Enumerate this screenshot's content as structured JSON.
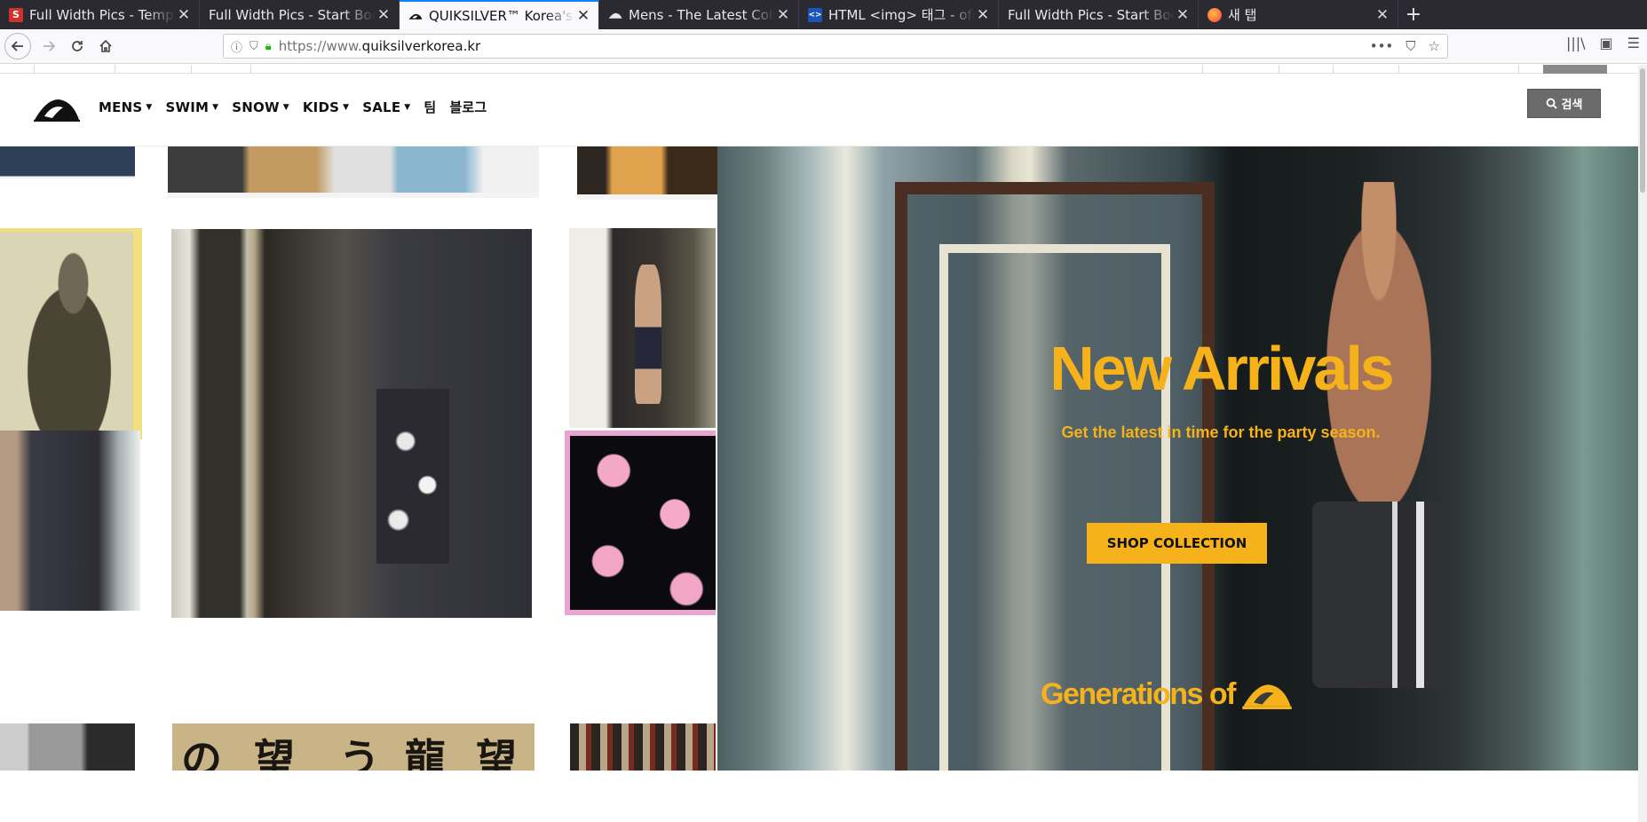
{
  "browser": {
    "tabs": [
      {
        "title": "Full Width Pics - Template",
        "favicon": "S",
        "favicon_bg": "#d0322b",
        "active": false
      },
      {
        "title": "Full Width Pics - Start Bootstrap",
        "favicon": "",
        "favicon_bg": "",
        "active": false
      },
      {
        "title": "QUIKSILVER™ Korea's Official",
        "favicon": "quiksilver-icon",
        "favicon_bg": "",
        "active": true
      },
      {
        "title": "Mens - The Latest Collection",
        "favicon": "quiksilver-icon",
        "favicon_bg": "",
        "active": false
      },
      {
        "title": "HTML <img> 태그 - ofcourse",
        "favicon": "<>",
        "favicon_bg": "#1a56b8",
        "active": false
      },
      {
        "title": "Full Width Pics - Start Bootstrap",
        "favicon": "",
        "favicon_bg": "",
        "active": false
      },
      {
        "title": "새 탭",
        "favicon": "firefox-icon",
        "favicon_bg": "#ff7139",
        "active": false
      }
    ],
    "new_tab_label": "+",
    "url_scheme": "https://www.",
    "url_host": "quiksilverkorea.kr"
  },
  "site": {
    "nav": [
      {
        "label": "MENS",
        "dropdown": true
      },
      {
        "label": "SWIM",
        "dropdown": true
      },
      {
        "label": "SNOW",
        "dropdown": true
      },
      {
        "label": "KIDS",
        "dropdown": true
      },
      {
        "label": "SALE",
        "dropdown": true
      },
      {
        "label": "팀",
        "dropdown": false
      },
      {
        "label": "블로그",
        "dropdown": false
      }
    ],
    "search_label": "검색"
  },
  "hero": {
    "title": "New Arrivals",
    "subtitle": "Get the latest in time for the party season.",
    "cta_label": "SHOP COLLECTION",
    "tagline": "Generations of",
    "accent_color": "#f5b21a"
  }
}
